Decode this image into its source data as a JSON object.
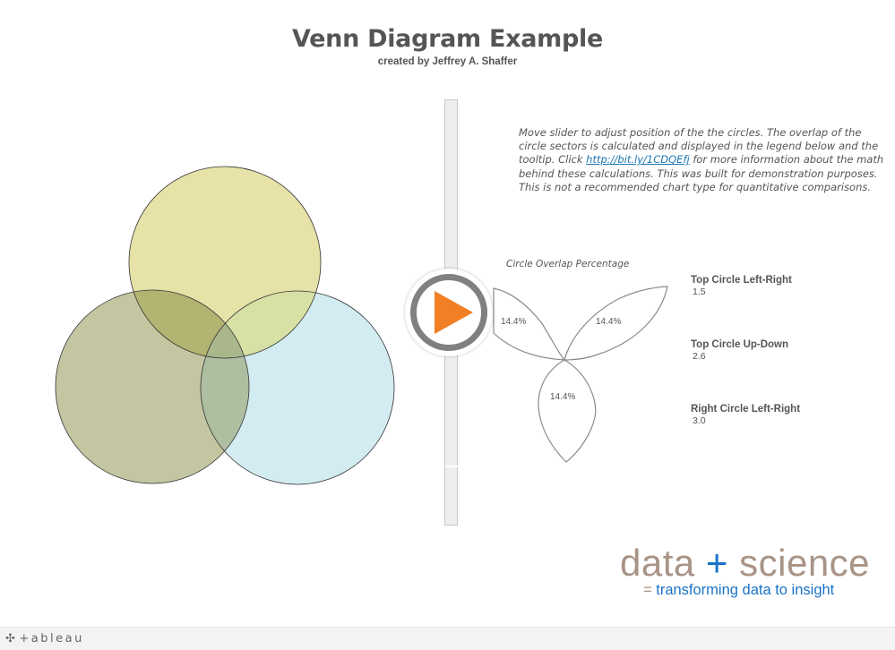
{
  "header": {
    "title": "Venn Diagram Example",
    "subtitle": "created by Jeffrey A. Shaffer"
  },
  "instructions": {
    "before_link": "Move slider to adjust position of the the circles. The overlap of the circle sectors is calculated and displayed in the legend below and the tooltip. Click ",
    "link": "http://bit.ly/1CDQEfj",
    "after_link": " for more information about the math behind these calculations. This was built for demonstration purposes. This is not a recommended chart type for quantitative comparisons."
  },
  "venn": {
    "circles": [
      {
        "name": "top",
        "color": "#e6e2a8"
      },
      {
        "name": "left",
        "color": "#c4c6a1"
      },
      {
        "name": "right",
        "color": "#d2ecf1"
      }
    ],
    "overlap_colors": {
      "top_left": "#b3b372",
      "top_right": "#d7e0a5",
      "left_right": "#adbea1",
      "all": "#a9b78b"
    }
  },
  "overlap_chart": {
    "title": "Circle Overlap Percentage",
    "percentages": [
      "14.4%",
      "14.4%",
      "14.4%"
    ]
  },
  "parameters": [
    {
      "label": "Top Circle Left-Right",
      "value": "1.5"
    },
    {
      "label": "Top Circle Up-Down",
      "value": "2.6"
    },
    {
      "label": "Right Circle Left-Right",
      "value": "3.0"
    }
  ],
  "logo": {
    "word1": "data",
    "plus": "+",
    "word2": "science",
    "eq": "=",
    "tagline": "transforming data to insight"
  },
  "footer": {
    "icon": "tableau-cross-icon",
    "brand": "+ableau"
  },
  "colors": {
    "accent_orange": "#f07f25",
    "play_ring": "#808080",
    "link_blue": "#1f78b4",
    "logo_brown": "#a89386",
    "logo_blue": "#1a73c8"
  }
}
